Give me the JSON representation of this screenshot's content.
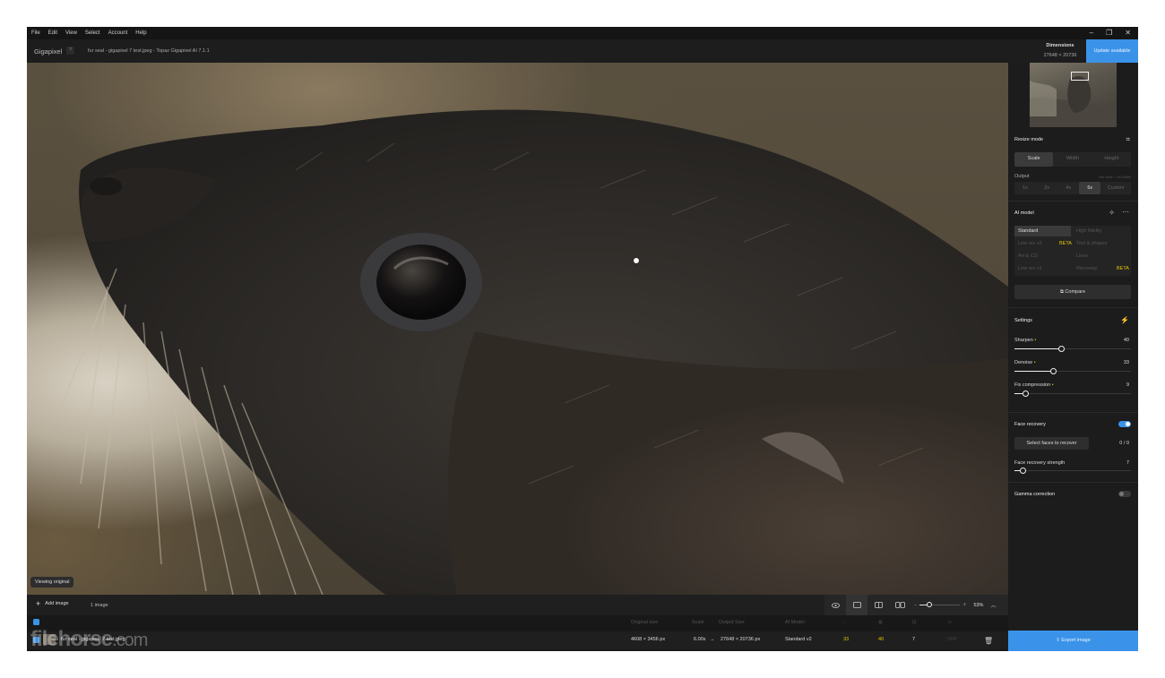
{
  "menu": [
    "File",
    "Edit",
    "View",
    "Select",
    "Account",
    "Help"
  ],
  "window_controls": {
    "minimize": "–",
    "restore": "❐",
    "close": "✕"
  },
  "titlebar": {
    "app_name": "Gigapixel",
    "help": "?",
    "file_title": "fur seal - gigapixel 7 test.jpeg - Topaz Gigapixel AI 7.1.1",
    "dimensions_label": "Dimensions",
    "dimensions_value": "27648 × 20736",
    "update_label": "Update available"
  },
  "canvas": {
    "viewing_label": "Viewing original"
  },
  "bottombar": {
    "add_image": "Add image",
    "image_count": "1 image",
    "zoom_value": "53%"
  },
  "filelist": {
    "headers": {
      "original_size": "Original size",
      "scale": "Scale",
      "output_size": "Output Size",
      "ai_model": "AI Model"
    },
    "row": {
      "name": "fur seal - gigapixel 7 test.jpeg",
      "original_size": "4608 × 3456 px",
      "scale": "6.00x",
      "arrow": "→",
      "output_size": "27648 × 20736 px",
      "model": "Standard v2",
      "sharpen": "33",
      "denoise": "40",
      "compression": "7",
      "face": "OFF"
    }
  },
  "panel": {
    "resize_mode": {
      "title": "Resize mode",
      "tabs": [
        "Scale",
        "Width",
        "Height"
      ],
      "active_tab": "Scale",
      "output_label": "Output",
      "file_size": "File Size: ~163.6MB",
      "scales": [
        "1x",
        "2x",
        "4x",
        "6x",
        "Custom"
      ],
      "active_scale": "6x"
    },
    "ai_model": {
      "title": "AI model",
      "models": {
        "standard": "Standard",
        "high_fidelity": "High fidelity",
        "low_res_v2": "Low res v2",
        "text_shapes": "Text & shapes",
        "art_cg": "Art & CG",
        "lines": "Lines",
        "low_res_v1": "Low res v1",
        "recovery": "Recovery"
      },
      "beta": "BETA",
      "compare": "Compare"
    },
    "settings": {
      "title": "Settings",
      "sharpen_label": "Sharpen",
      "sharpen_value": "40",
      "sharpen_level": 0.4,
      "denoise_label": "Denoise",
      "denoise_value": "33",
      "denoise_level": 0.33,
      "compression_label": "Fix compression",
      "compression_value": "9",
      "compression_level": 0.09
    },
    "face_recovery": {
      "title": "Face recovery",
      "enabled": true,
      "select_label": "Select faces to recover",
      "count": "0 / 0",
      "strength_label": "Face recovery strength",
      "strength_value": "7",
      "strength_level": 0.07
    },
    "gamma": {
      "title": "Gamma correction",
      "enabled": false
    },
    "export_label": "Export image"
  },
  "watermark": {
    "name": "filehorse",
    "suffix": ".com"
  },
  "colors": {
    "accent": "#3a93e8",
    "beta": "#e7c500",
    "background": "#161616"
  }
}
